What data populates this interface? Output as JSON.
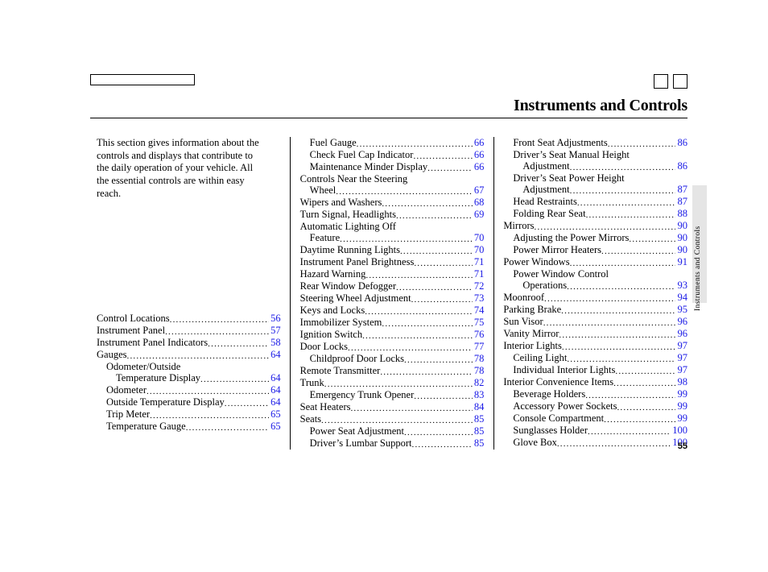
{
  "title": "Instruments and Controls",
  "intro": "This section gives information about the controls and displays that contribute to the daily operation of your vehicle. All the essential controls are within easy reach.",
  "side_label": "Instruments and Controls",
  "page_number": "55",
  "toc": [
    {
      "label": "Control Locations",
      "page": "56",
      "indent": 0
    },
    {
      "label": "Instrument Panel",
      "page": "57",
      "indent": 0
    },
    {
      "label": "Instrument Panel Indicators",
      "page": "58",
      "indent": 0
    },
    {
      "label": "Gauges",
      "page": "64",
      "indent": 0
    },
    {
      "label1": "Odometer/Outside",
      "label2": "Temperature Display",
      "page": "64",
      "indent": 1,
      "wrap": true
    },
    {
      "label": "Odometer",
      "page": "64",
      "indent": 1
    },
    {
      "label": "Outside Temperature Display",
      "page": "64",
      "indent": 1
    },
    {
      "label": "Trip Meter",
      "page": "65",
      "indent": 1
    },
    {
      "label": "Temperature Gauge",
      "page": "65",
      "indent": 1
    },
    {
      "label": "Fuel Gauge",
      "page": "66",
      "indent": 1,
      "colbreak_before": true
    },
    {
      "label": "Check Fuel Cap Indicator",
      "page": "66",
      "indent": 1
    },
    {
      "label": "Maintenance Minder Display",
      "page": "66",
      "indent": 1
    },
    {
      "label1": "Controls Near the Steering",
      "label2": "Wheel",
      "page": "67",
      "indent": 0,
      "wrap": true
    },
    {
      "label": "Wipers and Washers",
      "page": "68",
      "indent": 0
    },
    {
      "label": "Turn Signal, Headlights",
      "page": "69",
      "indent": 0
    },
    {
      "label1": "Automatic Lighting Off",
      "label2": "Feature",
      "page": "70",
      "indent": 0,
      "wrap": true
    },
    {
      "label": "Daytime Running Lights",
      "page": "70",
      "indent": 0
    },
    {
      "label": "Instrument Panel Brightness",
      "page": "71",
      "indent": 0
    },
    {
      "label": "Hazard Warning",
      "page": "71",
      "indent": 0
    },
    {
      "label": "Rear Window Defogger",
      "page": "72",
      "indent": 0
    },
    {
      "label": "Steering Wheel Adjustment",
      "page": "73",
      "indent": 0
    },
    {
      "label": "Keys and Locks",
      "page": "74",
      "indent": 0
    },
    {
      "label": "Immobilizer System",
      "page": "75",
      "indent": 0
    },
    {
      "label": "Ignition Switch",
      "page": "76",
      "indent": 0
    },
    {
      "label": "Door Locks",
      "page": "77",
      "indent": 0
    },
    {
      "label": "Childproof Door Locks",
      "page": "78",
      "indent": 1
    },
    {
      "label": "Remote Transmitter",
      "page": "78",
      "indent": 0
    },
    {
      "label": "Trunk",
      "page": "82",
      "indent": 0
    },
    {
      "label": "Emergency Trunk Opener",
      "page": "83",
      "indent": 1
    },
    {
      "label": "Seat Heaters",
      "page": "84",
      "indent": 0
    },
    {
      "label": "Seats",
      "page": "85",
      "indent": 0
    },
    {
      "label": "Power Seat Adjustment",
      "page": "85",
      "indent": 1
    },
    {
      "label": "Driver’s Lumbar Support",
      "page": "85",
      "indent": 1
    },
    {
      "label": "Front Seat Adjustments",
      "page": "86",
      "indent": 1,
      "colbreak_before": true
    },
    {
      "label1": "Driver’s Seat Manual Height",
      "label2": "Adjustment",
      "page": "86",
      "indent": 1,
      "wrap": true
    },
    {
      "label1": "Driver’s Seat Power Height",
      "label2": "Adjustment",
      "page": "87",
      "indent": 1,
      "wrap": true
    },
    {
      "label": "Head Restraints",
      "page": "87",
      "indent": 1
    },
    {
      "label": "Folding Rear Seat",
      "page": "88",
      "indent": 1
    },
    {
      "label": "Mirrors",
      "page": "90",
      "indent": 0
    },
    {
      "label": "Adjusting the Power Mirrors",
      "page": "90",
      "indent": 1
    },
    {
      "label": "Power Mirror Heaters",
      "page": "90",
      "indent": 1
    },
    {
      "label": "Power Windows",
      "page": "91",
      "indent": 0
    },
    {
      "label1": "Power Window Control",
      "label2": "Operations",
      "page": "93",
      "indent": 1,
      "wrap": true
    },
    {
      "label": "Moonroof",
      "page": "94",
      "indent": 0
    },
    {
      "label": "Parking Brake",
      "page": "95",
      "indent": 0
    },
    {
      "label": "Sun Visor",
      "page": "96",
      "indent": 0
    },
    {
      "label": "Vanity Mirror",
      "page": "96",
      "indent": 0
    },
    {
      "label": "Interior Lights",
      "page": "97",
      "indent": 0
    },
    {
      "label": "Ceiling Light",
      "page": "97",
      "indent": 1
    },
    {
      "label": "Individual Interior Lights",
      "page": "97",
      "indent": 1
    },
    {
      "label": "Interior Convenience Items",
      "page": "98",
      "indent": 0
    },
    {
      "label": "Beverage Holders",
      "page": "99",
      "indent": 1
    },
    {
      "label": "Accessory Power Sockets",
      "page": "99",
      "indent": 1
    },
    {
      "label": "Console Compartment",
      "page": "99",
      "indent": 1
    },
    {
      "label": "Sunglasses Holder",
      "page": "100",
      "indent": 1
    },
    {
      "label": "Glove Box",
      "page": "100",
      "indent": 1
    }
  ]
}
